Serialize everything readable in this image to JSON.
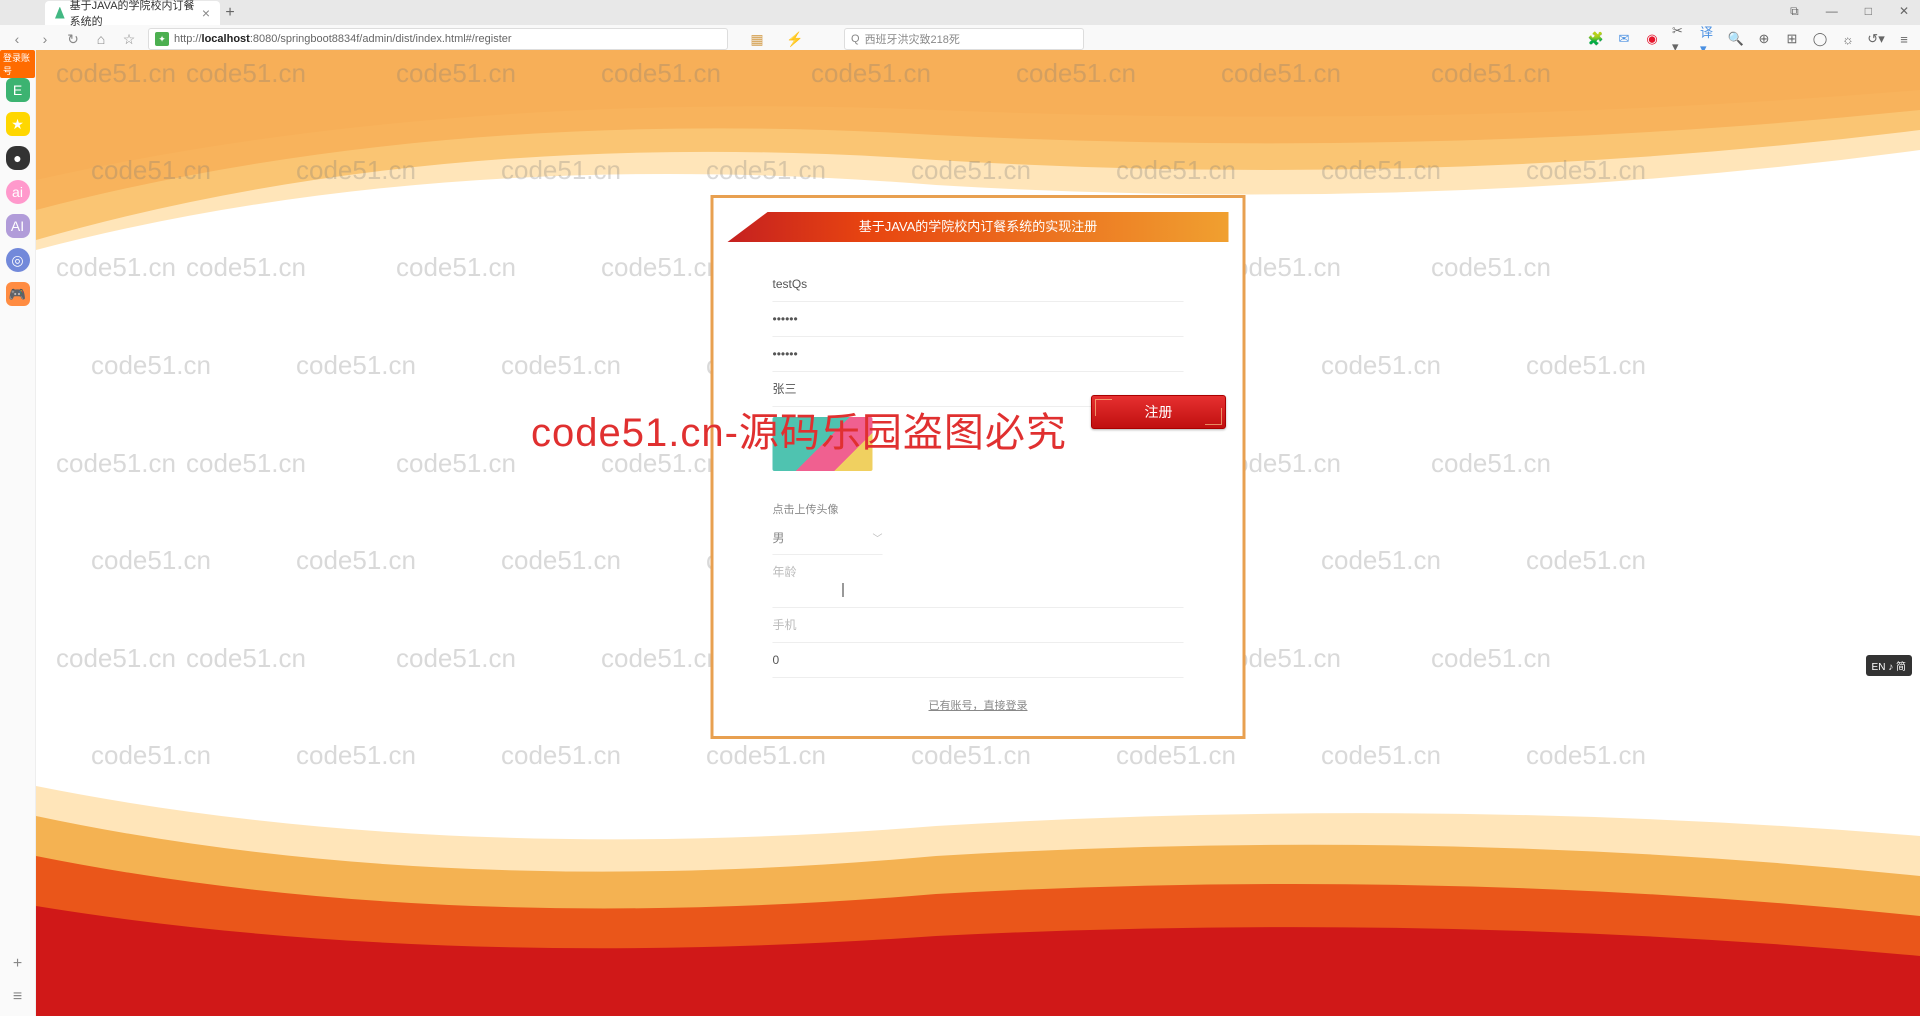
{
  "browser": {
    "tab_title": "基于JAVA的学院校内订餐系统的",
    "url_prefix": "http://",
    "url_host": "localhost",
    "url_port_path": ":8080/springboot8834f/admin/dist/index.html#/register",
    "search_placeholder": "西班牙洪灾致218死"
  },
  "window_controls": {
    "min": "—",
    "max": "□",
    "close": "✕",
    "restore": "⧉"
  },
  "sidebar": {
    "badge": "登录账号"
  },
  "register": {
    "title": "基于JAVA的学院校内订餐系统的实现注册",
    "username_value": "testQs",
    "password_value": "••••••",
    "confirm_value": "••••••",
    "realname_value": "张三",
    "avatar_label": "点击上传头像",
    "gender_value": "男",
    "age_placeholder": "年龄",
    "phone_placeholder": "手机",
    "balance_value": "0",
    "login_link": "已有账号，直接登录",
    "submit_label": "注册"
  },
  "watermark_text": "code51.cn",
  "big_watermark": "code51.cn-源码乐园盗图必究",
  "ime": "EN ♪ 简"
}
